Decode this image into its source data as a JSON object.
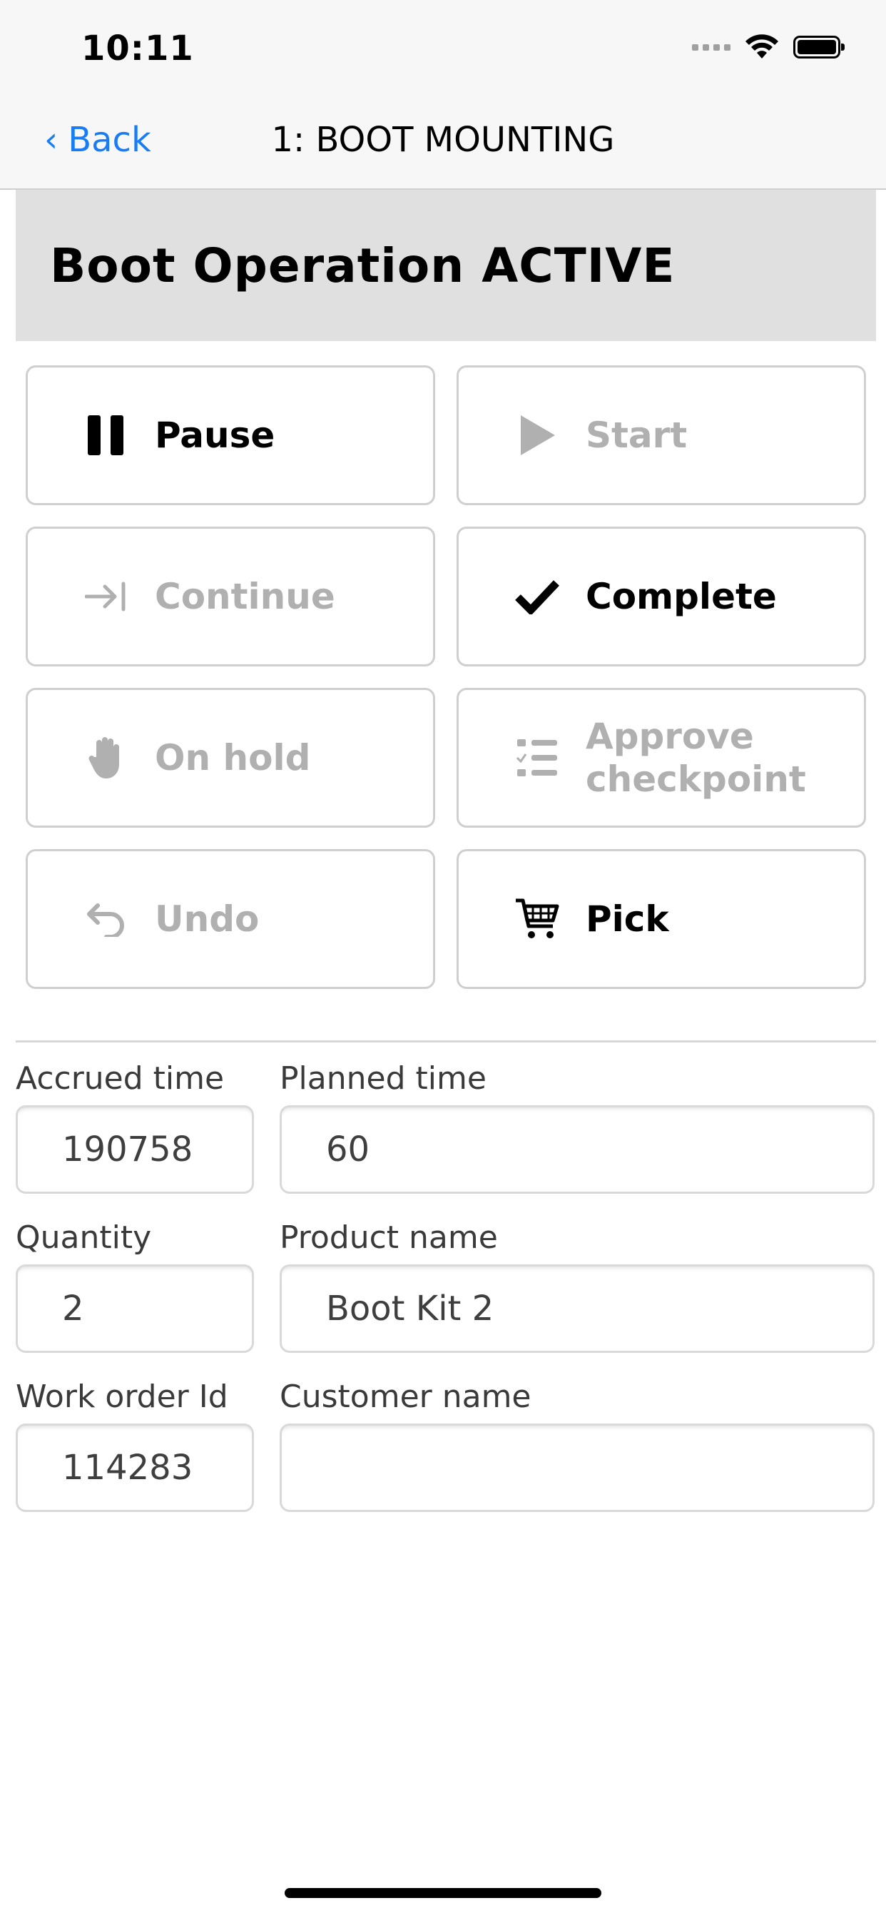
{
  "status_bar": {
    "time": "10:11"
  },
  "nav": {
    "back_label": "Back",
    "back_chevron": "‹",
    "title": "1: BOOT MOUNTING"
  },
  "header": {
    "title": "Boot Operation ACTIVE"
  },
  "actions": {
    "pause": {
      "label": "Pause",
      "icon": "pause-icon",
      "enabled": true
    },
    "start": {
      "label": "Start",
      "icon": "play-icon",
      "enabled": false
    },
    "continue": {
      "label": "Continue",
      "icon": "arrow-to-bar-icon",
      "enabled": false
    },
    "complete": {
      "label": "Complete",
      "icon": "checkmark-icon",
      "enabled": true
    },
    "on_hold": {
      "label": "On hold",
      "icon": "hand-icon",
      "enabled": false
    },
    "approve_checkpoint": {
      "label": "Approve checkpoint",
      "icon": "checklist-icon",
      "enabled": false
    },
    "undo": {
      "label": "Undo",
      "icon": "undo-icon",
      "enabled": false
    },
    "pick": {
      "label": "Pick",
      "icon": "cart-icon",
      "enabled": true
    }
  },
  "fields": {
    "accrued_time": {
      "label": "Accrued time",
      "value": "190758"
    },
    "planned_time": {
      "label": "Planned time",
      "value": "60"
    },
    "quantity": {
      "label": "Quantity",
      "value": "2"
    },
    "product_name": {
      "label": "Product name",
      "value": "Boot Kit 2"
    },
    "work_order_id": {
      "label": "Work order Id",
      "value": "114283"
    },
    "customer_name": {
      "label": "Customer name",
      "value": ""
    }
  },
  "colors": {
    "accent": "#1a7cf5",
    "enabled_text": "#000000",
    "disabled_text": "#b0b0b0",
    "header_bg": "#e0e0e0"
  }
}
